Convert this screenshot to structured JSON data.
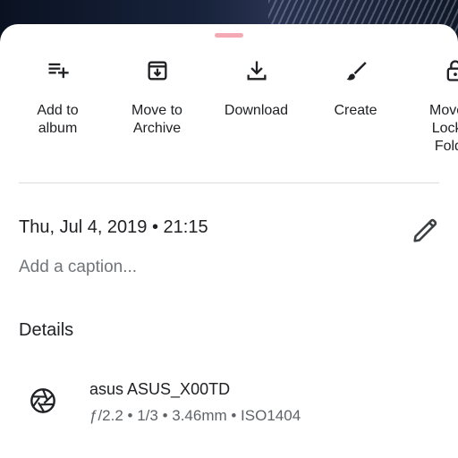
{
  "actions": [
    {
      "label": "Add to\nalbum",
      "icon": "playlist-add-icon"
    },
    {
      "label": "Move to\nArchive",
      "icon": "archive-icon"
    },
    {
      "label": "Download",
      "icon": "download-icon"
    },
    {
      "label": "Create",
      "icon": "brush-icon"
    },
    {
      "label": "Move to\nLocked\nFolder",
      "icon": "lock-icon"
    }
  ],
  "info": {
    "datetime": "Thu, Jul 4, 2019 • 21:15",
    "caption_placeholder": "Add a caption..."
  },
  "details": {
    "title": "Details",
    "camera": "asus ASUS_X00TD",
    "specs": "ƒ/2.2 • 1/3 • 3.46mm • ISO1404"
  },
  "colors": {
    "handle": "#f4a9b5",
    "text": "#202124",
    "secondary": "#5f6368"
  }
}
